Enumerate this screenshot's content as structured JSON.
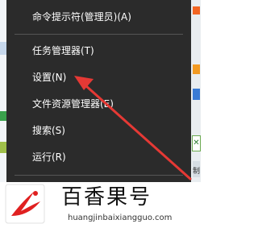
{
  "context_menu": {
    "items": [
      {
        "label": "命令提示符(管理员)(A)"
      },
      {
        "label": "任务管理器(T)"
      },
      {
        "label": "设置(N)"
      },
      {
        "label": "文件资源管理器(E)"
      },
      {
        "label": "搜索(S)"
      },
      {
        "label": "运行(R)"
      }
    ]
  },
  "background": {
    "edge_label": "制"
  },
  "watermark": {
    "name": "百香果号",
    "url": "huangjinbaixiangguo.com"
  },
  "colors": {
    "menu_bg": "#2b2b2b",
    "menu_text": "#ffffff",
    "arrow": "#e53935",
    "logo_red": "#e02020"
  },
  "icons": [
    "arrow-annotation",
    "brand-logo-icon"
  ]
}
